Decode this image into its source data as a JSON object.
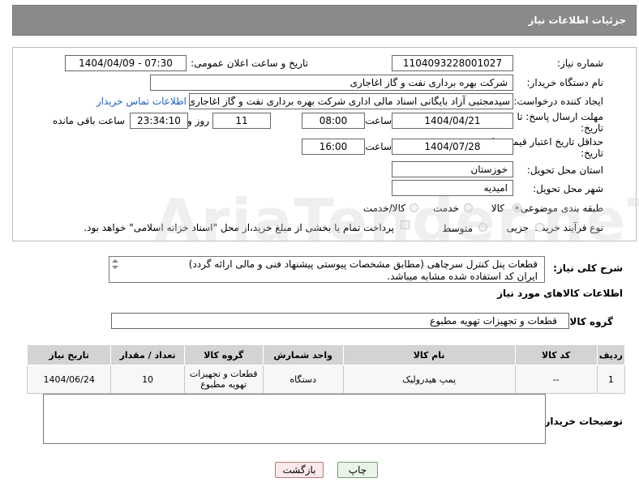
{
  "header": {
    "title": "جزئیات اطلاعات نیاز"
  },
  "form": {
    "need_number_label": "شماره نیاز:",
    "need_number": "1104093228001027",
    "announce_label": "تاریخ و ساعت اعلان عمومی:",
    "announce_value": "1404/04/09 - 07:30",
    "buyer_org_label": "نام دستگاه خریدار:",
    "buyer_org": "شرکت بهره برداری نفت و گاز اغاجاری",
    "creator_label": "ایجاد کننده درخواست:",
    "creator": "سیدمجتبی آزاد بایگانی اسناد مالی اداری شرکت بهره برداری نفت و گاز اغاجاری",
    "contact_link": "اطلاعات تماس خریدار",
    "deadline_label": "مهلت ارسال پاسخ: تا تاریخ:",
    "deadline_date": "1404/04/21",
    "time_word": "ساعت",
    "deadline_time": "08:00",
    "days": "11",
    "days_word": "روز و",
    "remaining_time": "23:34:10",
    "remaining_word": "ساعت باقی مانده",
    "min_price_label": "حداقل تاریخ اعتبار قیمت: تا تاریخ:",
    "min_price_date": "1404/07/28",
    "min_price_time": "16:00",
    "province_label": "استان محل تحویل:",
    "province": "خوزستان",
    "city_label": "شهر محل تحویل:",
    "city": "امیدیه",
    "category_label": "طبقه بندی موضوعی:",
    "cat_goods": "کالا",
    "cat_service": "خدمت",
    "cat_both": "کالا/خدمت",
    "process_label": "نوع فرآیند خرید :",
    "proc_partial": "جزیی",
    "proc_medium": "متوسط",
    "payment_note": "پرداخت تمام یا بخشی از مبلغ خرید،از محل \"اسناد خزانه اسلامی\" خواهد بود."
  },
  "description": {
    "label": "شرح کلی نیاز:",
    "line1": "قطعات پنل کنترل سرچاهی (مطابق مشخصات پیوستی پیشنهاد فنی و مالی ارائه گردد)",
    "line2": "ایران کد استفاده شده مشابه میباشد."
  },
  "goods_info": {
    "title": "اطلاعات کالاهای مورد نیاز",
    "group_label": "گروه کالا:",
    "group_value": "قطعات و تجهیزات تهویه مطبوع"
  },
  "table": {
    "headers": [
      "ردیف",
      "کد کالا",
      "نام کالا",
      "واحد شمارش",
      "گروه کالا",
      "تعداد / مقدار",
      "تاریخ نیاز"
    ],
    "rows": [
      {
        "row": "1",
        "code": "--",
        "name": "پمپ هیدرولیک",
        "unit": "دستگاه",
        "group": "قطعات و تجهیزات تهویه مطبوع",
        "qty": "10",
        "date": "1404/06/24"
      }
    ]
  },
  "buyer_notes": {
    "label": "توضیحات خریدار:",
    "value": ""
  },
  "buttons": {
    "print": "چاپ",
    "back": "بازگشت"
  },
  "watermark": "AriaTender.neT"
}
